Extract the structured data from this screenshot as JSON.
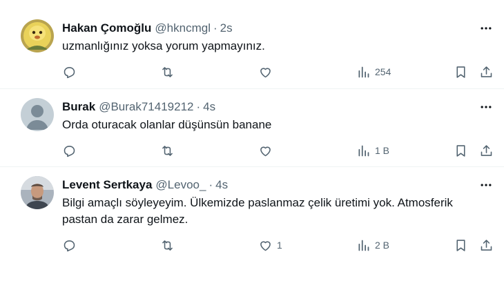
{
  "tweets": [
    {
      "name": "Hakan Çomoğlu",
      "handle": "@hkncmgl",
      "separator": "·",
      "time": "2s",
      "text": "uzmanlığınız yoksa yorum yapmayınız.",
      "reply_count": "",
      "retweet_count": "",
      "like_count": "",
      "view_count": "254",
      "avatar_icon": "yellow-character-avatar"
    },
    {
      "name": "Burak",
      "handle": "@Burak71419212",
      "separator": "·",
      "time": "4s",
      "text": "Orda oturacak olanlar düşünsün banane",
      "reply_count": "",
      "retweet_count": "",
      "like_count": "",
      "view_count": "1 B",
      "avatar_icon": "default-profile-avatar"
    },
    {
      "name": "Levent Sertkaya",
      "handle": "@Levoo_",
      "separator": "·",
      "time": "4s",
      "text": "Bilgi amaçlı söyleyeyim. Ülkemizde paslanmaz çelik üretimi yok. Atmosferik pastan da zarar gelmez.",
      "reply_count": "",
      "retweet_count": "",
      "like_count": "1",
      "view_count": "2 B",
      "avatar_icon": "photo-avatar"
    }
  ],
  "colors": {
    "text": "#0f1419",
    "secondary": "#536471",
    "divider": "#eff3f4"
  }
}
